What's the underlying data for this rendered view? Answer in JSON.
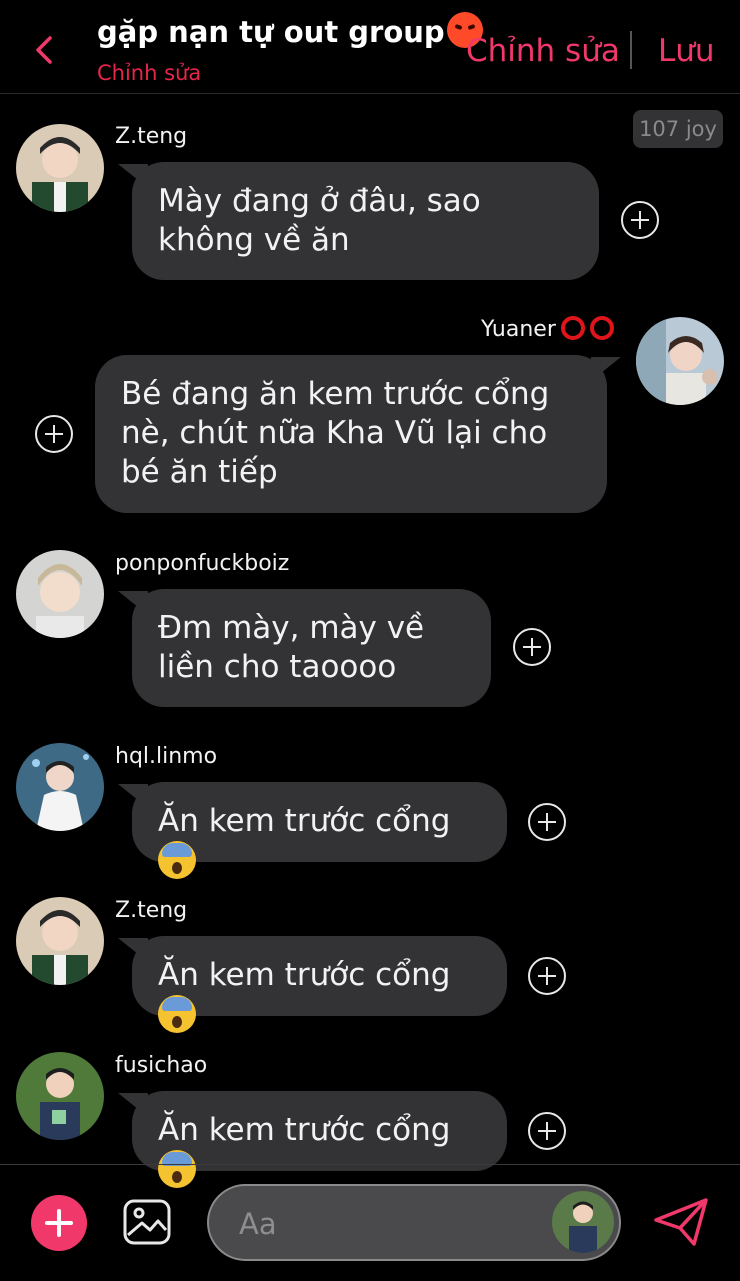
{
  "header": {
    "title": "gặp nạn tự out group",
    "title_emoji": "angry-face",
    "subtitle": "Chỉnh sửa",
    "edit_label": "Chỉnh sửa",
    "save_label": "Lưu",
    "accent_color": "#f0386b"
  },
  "badge": {
    "text": "107 joy"
  },
  "messages": [
    {
      "sender": "Z.teng",
      "side": "left",
      "text": "Mày đang ở đâu, sao không về ăn"
    },
    {
      "sender": "Yuaner",
      "sender_suffix": "rings",
      "side": "right",
      "text": "Bé đang ăn kem trước cổng nè, chút nữa Kha Vũ lại cho bé ăn tiếp"
    },
    {
      "sender": "ponponfuckboiz",
      "side": "left",
      "text": "Đm mày, mày về liền cho taoooo"
    },
    {
      "sender": "hql.linmo",
      "side": "left",
      "text": "Ăn kem trước cổng",
      "emoji": "scared-face"
    },
    {
      "sender": "Z.teng",
      "side": "left",
      "text": "Ăn kem trước cổng",
      "emoji": "scared-face"
    },
    {
      "sender": "fusichao",
      "side": "left",
      "text": "Ăn kem trước cổng",
      "emoji": "scared-face"
    }
  ],
  "composer": {
    "placeholder": "Aa",
    "value": ""
  }
}
